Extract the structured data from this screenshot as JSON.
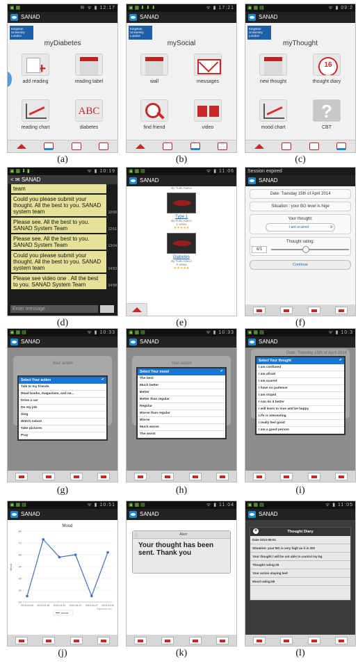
{
  "app_name": "SANAD",
  "status_times": {
    "a": "12:17",
    "b": "17:21",
    "c": "09:2",
    "d": "10:19",
    "e": "11:06",
    "g": "10:33",
    "h": "10:33",
    "i": "10:3",
    "j": "10:51",
    "k": "11:04",
    "l": "11:05"
  },
  "captions": [
    "(a)",
    "(b)",
    "(c)",
    "(d)",
    "(e)",
    "(f)",
    "(g)",
    "(h)",
    "(i)",
    "(j)",
    "(k)",
    "(l)"
  ],
  "kingston": "Kingston University London",
  "screen_a": {
    "title": "myDiabetes",
    "tiles": [
      "add reading",
      "reading tabel",
      "reading chart",
      "diabetes"
    ]
  },
  "screen_b": {
    "title": "mySocial",
    "tiles": [
      "wall",
      "messages",
      "find friend",
      "video"
    ]
  },
  "screen_c": {
    "title": "myThought",
    "tiles": [
      "new thought",
      "thought diary",
      "mood chart",
      "CBT"
    ]
  },
  "screen_d": {
    "header": "SANAD",
    "top_fragment": "team",
    "messages": [
      {
        "text": "Could you please submit your thought. All the best to you. SANAD system team",
        "time": "10:58"
      },
      {
        "text": "Please see. All the best to you. SANAD System Team",
        "time": "12:51"
      },
      {
        "text": "Please see. All the best to you. SANAD System Team",
        "time": "13:04"
      },
      {
        "text": "Could you please submit your thought. All the best to you. SANAD system team",
        "time": "14:53"
      },
      {
        "text": "Please see video one . All the best to you. SANAD System Team",
        "time": "14:58"
      }
    ],
    "input_placeholder": "Enter message"
  },
  "screen_e": {
    "by_top": "By Turki Alanzi",
    "videos": [
      {
        "title": "Type 1",
        "by": "By Turki Alanzi",
        "views": "1 views",
        "stars": "★★★★★"
      },
      {
        "title": "Diabetes",
        "by": "By Turki Alanzi",
        "views": "0 views",
        "stars": "★★★★★"
      }
    ]
  },
  "screen_f": {
    "session": "Session expired",
    "date": "Date: Tuesday 15th of April 2014",
    "situation": "Situation : your BG level is hige",
    "your_thought_label": "Your thought:",
    "your_thought_value": "I am scared",
    "rating_label": "Thought rating:",
    "rating_value": "6/1",
    "continue": "Continue"
  },
  "screen_g": {
    "bg_title": "Your action",
    "header": "Select Your action",
    "items": [
      "Talk to my friends",
      "Read books, magazines, and ne...",
      "Drive a car",
      "Do my job",
      "Sing",
      "Watch nature",
      "Take pictures",
      "Pray"
    ]
  },
  "screen_h": {
    "bg_title": "Your action",
    "header": "Select Your mood",
    "items": [
      "The best",
      "Much better",
      "Better",
      "Better than regular",
      "Regular",
      "Worse than regular",
      "Worse",
      "Much worse",
      "The worst"
    ]
  },
  "screen_i": {
    "bg_title": "Date: Tuesday 15th of April 2014",
    "header": "Select Your thought",
    "items": [
      "I am confused",
      "I am afraid",
      "I am scared",
      "I have no patience",
      "I am stupid",
      "I can do it better",
      "I will learn to love and be happy",
      "Life is interesting",
      "I really feel good",
      "I am a good person"
    ]
  },
  "screen_k": {
    "alert_title": "Alert",
    "alert_text": "Your thought has been sent. Thank you"
  },
  "screen_l": {
    "title": "Thought Diary",
    "rows": [
      "Date 2013-05-01",
      "Situation: your BG is very high as it is 200",
      "Your thought I will be not able to control my bg",
      "Thought rating:25",
      "Your action staying bed",
      "Mood rating:65"
    ]
  },
  "chart_data": {
    "type": "line",
    "title": "Mood",
    "xlabel": "",
    "ylabel": "Mood",
    "categories": [
      "2013-04-08",
      "2013-04-08",
      "2013-04-11",
      "2013-04-27",
      "2013-04-27",
      "2013-04-30"
    ],
    "series": [
      {
        "name": "mood",
        "values": [
          25,
          73,
          58,
          60,
          25,
          62
        ]
      }
    ],
    "ylim": [
      20,
      80
    ],
    "yticks": [
      "20",
      "30",
      "40",
      "50",
      "60",
      "70",
      "80"
    ],
    "legend": "bottom",
    "credit": "Highcharts.com",
    "line_color": "#3d6fb5"
  }
}
